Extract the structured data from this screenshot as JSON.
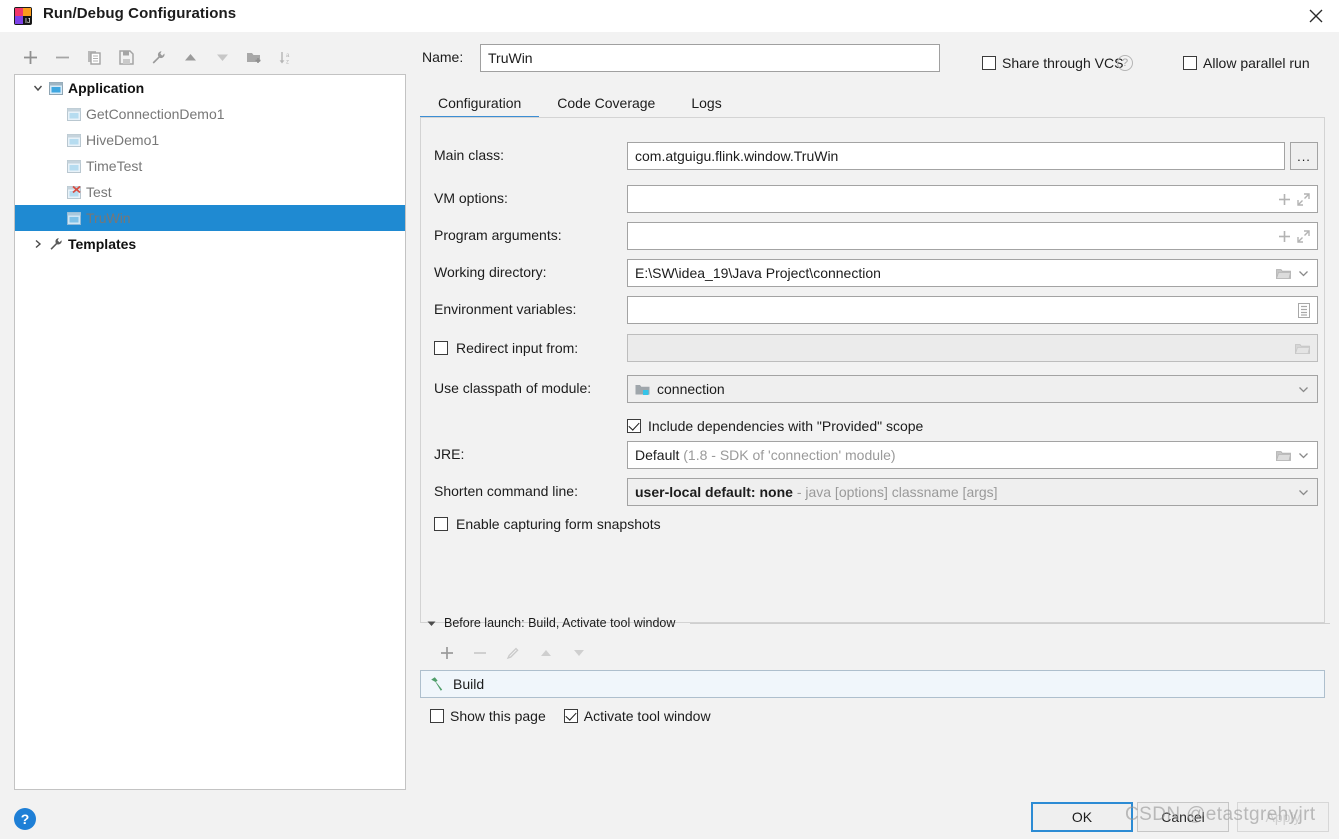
{
  "window": {
    "title": "Run/Debug Configurations",
    "app_icon": "intellij-idea-icon",
    "close_icon": "close-icon"
  },
  "toolbar": {
    "buttons": [
      {
        "name": "add-configuration-button",
        "icon": "plus-icon",
        "glyph": "+"
      },
      {
        "name": "remove-configuration-button",
        "icon": "minus-icon",
        "glyph": "−"
      },
      {
        "name": "copy-configuration-button",
        "icon": "copy-icon",
        "glyph": "❐"
      },
      {
        "name": "save-configuration-button",
        "icon": "save-icon",
        "glyph": "ὋE"
      },
      {
        "name": "edit-templates-button",
        "icon": "wrench-icon",
        "glyph": "ὒ7"
      },
      {
        "name": "move-up-button",
        "icon": "arrow-up-icon",
        "glyph": "▲"
      },
      {
        "name": "move-down-button",
        "icon": "arrow-down-icon",
        "glyph": "▼"
      },
      {
        "name": "new-folder-button",
        "icon": "new-folder-icon",
        "glyph": "Ὄ1"
      },
      {
        "name": "sort-alphabetically-button",
        "icon": "sort-az-icon",
        "glyph": "↓az"
      }
    ]
  },
  "tree": {
    "nodes": [
      {
        "label": "Application",
        "type": "group",
        "expanded": true,
        "selected": false,
        "icon": "application-icon"
      },
      {
        "label": "GetConnectionDemo1",
        "type": "child",
        "selected": false,
        "icon": "application-icon"
      },
      {
        "label": "HiveDemo1",
        "type": "child",
        "selected": false,
        "icon": "application-icon"
      },
      {
        "label": "TimeTest",
        "type": "child",
        "selected": false,
        "icon": "application-icon"
      },
      {
        "label": "Test",
        "type": "child",
        "selected": false,
        "icon": "application-error-icon"
      },
      {
        "label": "TruWin",
        "type": "child",
        "selected": true,
        "icon": "application-icon"
      },
      {
        "label": "Templates",
        "type": "group",
        "expanded": false,
        "selected": false,
        "icon": "wrench-icon"
      }
    ]
  },
  "name_row": {
    "label": "Name:",
    "value": "TruWin",
    "placeholder": "",
    "share_vcs_label": "Share through VCS",
    "share_vcs_checked": false,
    "help_glyph": "?",
    "allow_parallel_label": "Allow parallel run",
    "allow_parallel_checked": false
  },
  "tabs": [
    {
      "label": "Configuration",
      "active": true
    },
    {
      "label": "Code Coverage",
      "active": false
    },
    {
      "label": "Logs",
      "active": false
    }
  ],
  "fields": {
    "main_class": {
      "label": "Main class:",
      "value": "com.atguigu.flink.window.TruWin",
      "browse_label": "..."
    },
    "vm_options": {
      "label": "VM options:",
      "value": "",
      "adorn_add": "+",
      "adorn_expand": "⤢"
    },
    "program_arguments": {
      "label": "Program arguments:",
      "value": "",
      "adorn_add": "+",
      "adorn_expand": "⤢"
    },
    "working_directory": {
      "label": "Working directory:",
      "value": "E:\\SW\\idea_19\\Java Project\\connection"
    },
    "environment_variables": {
      "label": "Environment variables:",
      "value": ""
    },
    "redirect_input": {
      "label": "Redirect input from:",
      "checked": false,
      "value": ""
    },
    "use_classpath_of_module": {
      "label": "Use classpath of module:",
      "value": "connection",
      "icon": "module-icon"
    },
    "include_provided": {
      "label": "Include dependencies with \"Provided\" scope",
      "checked": true
    },
    "jre": {
      "label": "JRE:",
      "value": "Default",
      "hint": "(1.8 - SDK of 'connection' module)"
    },
    "shorten_command_line": {
      "label": "Shorten command line:",
      "value": "user-local default: none",
      "hint": "- java [options] classname [args]"
    },
    "enable_snapshots": {
      "label": "Enable capturing form snapshots",
      "checked": false
    }
  },
  "before_launch": {
    "header": "Before launch: Build, Activate tool window",
    "collapse_icon": "triangle-down-icon",
    "toolbar": [
      {
        "name": "add-task-button",
        "icon": "plus-icon",
        "glyph": "+",
        "enabled": true
      },
      {
        "name": "remove-task-button",
        "icon": "minus-icon",
        "glyph": "−",
        "enabled": false
      },
      {
        "name": "edit-task-button",
        "icon": "pencil-icon",
        "glyph": "✎",
        "enabled": false
      },
      {
        "name": "move-task-up-button",
        "icon": "arrow-up-icon",
        "glyph": "▲",
        "enabled": false
      },
      {
        "name": "move-task-down-button",
        "icon": "arrow-down-icon",
        "glyph": "▼",
        "enabled": false
      }
    ],
    "items": [
      {
        "label": "Build",
        "icon": "hammer-icon"
      }
    ],
    "show_this_page_label": "Show this page",
    "show_this_page_checked": false,
    "activate_tool_window_label": "Activate tool window",
    "activate_tool_window_checked": true
  },
  "footer": {
    "help_glyph": "?",
    "help_icon": "help-circle-icon",
    "ok_label": "OK",
    "cancel_label": "Cancel",
    "apply_label": "Apply",
    "watermark": "CSDN @etastgrehyjrt"
  },
  "colors": {
    "accent_blue": "#1f8ad2",
    "tab_underline": "#3c8ed4",
    "help_blue": "#1e7fd6",
    "hammer_green": "#4f9e6a",
    "error_red": "#d64d42"
  }
}
